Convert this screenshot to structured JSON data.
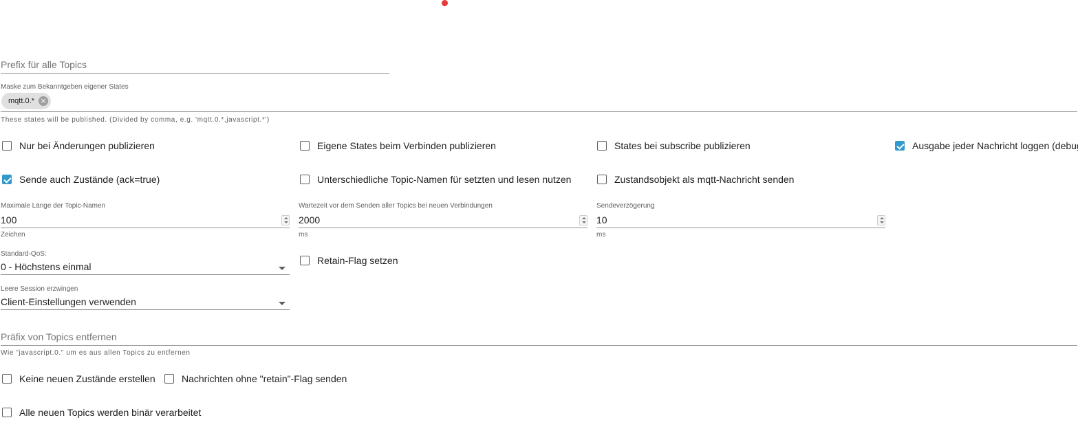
{
  "prefix_all_topics": {
    "placeholder": "Prefix für alle Topics",
    "value": ""
  },
  "mask": {
    "label": "Maske zum Bekanntgeben eigener States",
    "chips": [
      {
        "text": "mqtt.0.*"
      }
    ],
    "helper": "These states will be published. (Divided by comma, e.g. 'mqtt.0.*,javascript.*')"
  },
  "checkbox_rows": [
    [
      {
        "label": "Nur bei Änderungen publizieren",
        "checked": false
      },
      {
        "label": "Eigene States beim Verbinden publizieren",
        "checked": false
      },
      {
        "label": "States bei subscribe publizieren",
        "checked": false
      },
      {
        "label": "Ausgabe jeder Nachricht loggen (debug)",
        "checked": true
      }
    ],
    [
      {
        "label": "Sende auch Zustände (ack=true)",
        "checked": true
      },
      {
        "label": "Unterschiedliche Topic-Namen für setzten und lesen nutzen",
        "checked": false
      },
      {
        "label": "Zustandsobjekt als mqtt-Nachricht senden",
        "checked": false
      }
    ]
  ],
  "numbers": [
    {
      "label": "Maximale Länge der Topic-Namen",
      "value": "100",
      "unit": "Zeichen"
    },
    {
      "label": "Wartezeit vor dem Senden aller Topics bei neuen Verbindungen",
      "value": "2000",
      "unit": "ms"
    },
    {
      "label": "Sendeverzögerung",
      "value": "10",
      "unit": "ms"
    }
  ],
  "qos": {
    "label": "Standard-QoS:",
    "value": "0 - Höchstens einmal"
  },
  "retain": {
    "label": "Retain-Flag setzen",
    "checked": false
  },
  "clean_session": {
    "label": "Leere Session erzwingen",
    "value": "Client-Einstellungen verwenden"
  },
  "remove_prefix": {
    "placeholder": "Präfix von Topics entfernen",
    "value": "",
    "helper": "Wie \"javascript.0.\" um es aus allen Topics zu entfernen"
  },
  "bottom_checkboxes": [
    {
      "label": "Keine neuen Zustände erstellen",
      "checked": false
    },
    {
      "label": "Nachrichten ohne \"retain\"-Flag senden",
      "checked": false
    },
    {
      "label": "Alle neuen Topics werden binär verarbeitet",
      "checked": false
    }
  ],
  "colors": {
    "accent": "#3399cc",
    "indicator_dot": "#e53935",
    "underline": "#949494"
  }
}
